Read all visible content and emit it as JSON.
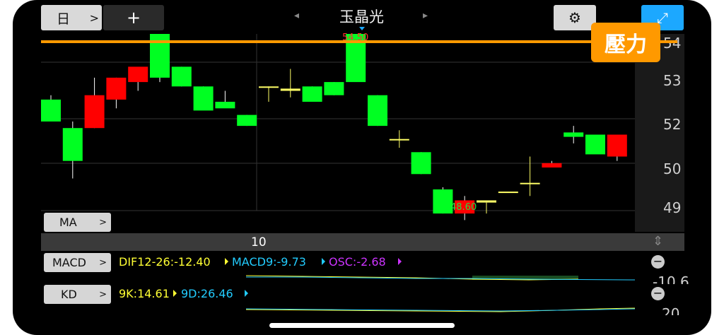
{
  "toolbar": {
    "period_label": "日",
    "period_chevron": ">",
    "add_label": "+",
    "prev_arrow": "◂",
    "stock_name": "玉晶光",
    "next_arrow": "▸",
    "gear_glyph": "⚙",
    "fullscreen_glyph": "⤢"
  },
  "main_chart": {
    "high_label": "54.50",
    "low_label": "48.60",
    "resistance_label": "壓力",
    "resistance_color": "#ff9900",
    "y_axis_labels": [
      "54",
      "53",
      "52",
      "50",
      "49"
    ],
    "ma_label": "MA",
    "ma_chevron": ">"
  },
  "period_bar": {
    "value": "10",
    "stepper_glyph": "⇕"
  },
  "macd": {
    "label": "MACD",
    "chevron": ">",
    "dif": "DIF12-26:-12.40",
    "macd9": "MACD9:-9.73",
    "osc": "OSC:-2.68",
    "axis": "-10.6",
    "remove_glyph": "−"
  },
  "kd": {
    "label": "KD",
    "chevron": ">",
    "k": "9K:14.61",
    "d": "9D:26.46",
    "axis": "20",
    "remove_glyph": "−"
  },
  "colors": {
    "up": "#ff0000",
    "down": "#00ff22",
    "doji": "#ffff66",
    "dif": "#ffff33",
    "macd9": "#22ccff",
    "osc": "#cc33ff",
    "accent_blue": "#1ca8ff"
  },
  "chart_data": {
    "type": "candlestick",
    "candles": [
      {
        "o": 52.55,
        "h": 52.65,
        "l": 52.1,
        "c": 52.05
      },
      {
        "o": 51.9,
        "h": 52.05,
        "l": 50.75,
        "c": 51.15
      },
      {
        "o": 51.9,
        "h": 53.05,
        "l": 51.9,
        "c": 52.65
      },
      {
        "o": 52.55,
        "h": 53.05,
        "l": 52.35,
        "c": 53.05
      },
      {
        "o": 52.95,
        "h": 53.25,
        "l": 52.75,
        "c": 53.3
      },
      {
        "o": 54.2,
        "h": 54.2,
        "l": 52.95,
        "c": 53.05
      },
      {
        "o": 53.3,
        "h": 53.3,
        "l": 52.85,
        "c": 52.85
      },
      {
        "o": 52.85,
        "h": 52.85,
        "l": 52.35,
        "c": 52.3
      },
      {
        "o": 52.5,
        "h": 52.75,
        "l": 52.4,
        "c": 52.35
      },
      {
        "o": 52.2,
        "h": 52.2,
        "l": 51.95,
        "c": 51.95
      },
      {
        "o": 52.85,
        "h": 52.85,
        "l": 52.5,
        "c": 52.85
      },
      {
        "o": 52.8,
        "h": 53.25,
        "l": 52.6,
        "c": 52.75
      },
      {
        "o": 52.85,
        "h": 52.85,
        "l": 52.65,
        "c": 52.5
      },
      {
        "o": 52.95,
        "h": 52.95,
        "l": 52.65,
        "c": 52.65
      },
      {
        "o": 54.15,
        "h": 54.15,
        "l": 53.15,
        "c": 52.95
      },
      {
        "o": 52.65,
        "h": 52.65,
        "l": 51.95,
        "c": 51.95
      },
      {
        "o": 51.65,
        "h": 51.85,
        "l": 51.45,
        "c": 51.65
      },
      {
        "o": 51.35,
        "h": 51.35,
        "l": 50.85,
        "c": 50.85
      },
      {
        "o": 50.5,
        "h": 50.55,
        "l": 49.95,
        "c": 49.95
      },
      {
        "o": 49.95,
        "h": 50.35,
        "l": 49.8,
        "c": 50.25
      },
      {
        "o": 50.2,
        "h": 50.2,
        "l": 49.95,
        "c": 50.25
      },
      {
        "o": 50.45,
        "h": 50.45,
        "l": 50.45,
        "c": 50.45
      },
      {
        "o": 50.65,
        "h": 51.25,
        "l": 50.35,
        "c": 50.65
      },
      {
        "o": 51.0,
        "h": 51.15,
        "l": 51.0,
        "c": 51.1
      },
      {
        "o": 51.8,
        "h": 51.95,
        "l": 51.55,
        "c": 51.7
      },
      {
        "o": 51.75,
        "h": 51.75,
        "l": 51.35,
        "c": 51.3
      },
      {
        "o": 51.25,
        "h": 51.75,
        "l": 51.15,
        "c": 51.75
      }
    ],
    "resistance": 54.5,
    "high": 54.5,
    "low": 48.6
  }
}
